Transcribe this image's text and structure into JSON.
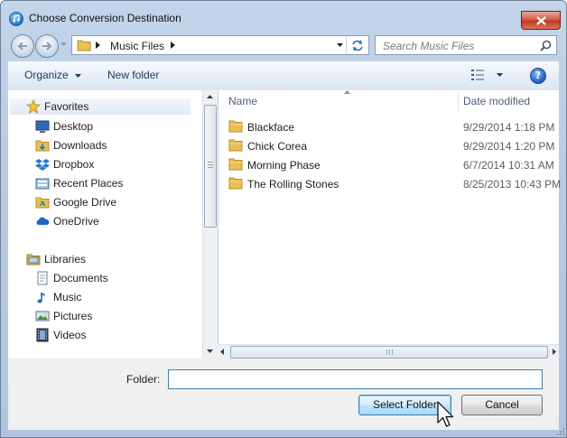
{
  "window": {
    "title": "Choose Conversion Destination"
  },
  "navigation": {
    "address_path": "Music Files",
    "search_placeholder": "Search Music Files"
  },
  "toolbar": {
    "organize_label": "Organize",
    "new_folder_label": "New folder"
  },
  "nav_pane": {
    "favorites": {
      "label": "Favorites",
      "items": [
        {
          "label": "Desktop",
          "icon": "desktop-icon"
        },
        {
          "label": "Downloads",
          "icon": "downloads-folder-icon"
        },
        {
          "label": "Dropbox",
          "icon": "dropbox-icon"
        },
        {
          "label": "Recent Places",
          "icon": "recent-places-icon"
        },
        {
          "label": "Google Drive",
          "icon": "google-drive-icon"
        },
        {
          "label": "OneDrive",
          "icon": "onedrive-icon"
        }
      ]
    },
    "libraries": {
      "label": "Libraries",
      "items": [
        {
          "label": "Documents",
          "icon": "documents-icon"
        },
        {
          "label": "Music",
          "icon": "music-icon"
        },
        {
          "label": "Pictures",
          "icon": "pictures-icon"
        },
        {
          "label": "Videos",
          "icon": "videos-icon"
        }
      ]
    }
  },
  "file_list": {
    "columns": {
      "name": "Name",
      "date": "Date modified"
    },
    "rows": [
      {
        "name": "Blackface",
        "date": "9/29/2014 1:18 PM"
      },
      {
        "name": "Chick Corea",
        "date": "9/29/2014 1:20 PM"
      },
      {
        "name": "Morning Phase",
        "date": "6/7/2014 10:31 AM"
      },
      {
        "name": "The Rolling Stones",
        "date": "8/25/2013 10:43 PM"
      }
    ]
  },
  "footer": {
    "folder_label": "Folder:",
    "folder_value": "",
    "select_button": "Select Folder",
    "cancel_button": "Cancel"
  },
  "colors": {
    "frame": "#b7cbe3",
    "close_button": "#c1391e",
    "folder_yellow": "#e8c055",
    "selected_button": "#bee6fd"
  }
}
